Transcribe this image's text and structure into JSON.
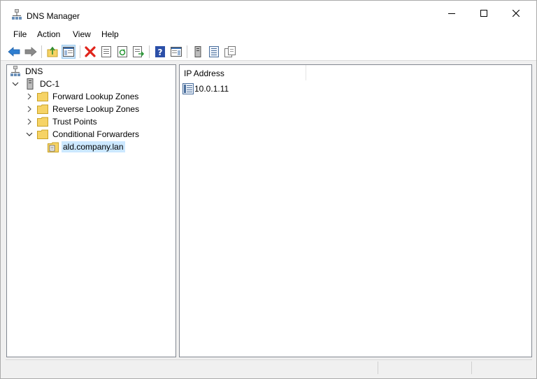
{
  "window": {
    "title": "DNS Manager"
  },
  "menu": {
    "items": [
      "File",
      "Action",
      "View",
      "Help"
    ]
  },
  "toolbar": {
    "buttons": [
      "back-icon",
      "forward-icon",
      "up-folder-icon",
      "show-hide-console-tree-icon",
      "delete-icon",
      "properties-icon",
      "refresh-icon",
      "export-list-icon",
      "help-icon",
      "show-hide-action-pane-icon",
      "server-icon",
      "list-icon",
      "copy-icon"
    ]
  },
  "tree": {
    "root": "DNS",
    "server": "DC-1",
    "folders": [
      {
        "label": "Forward Lookup Zones",
        "expanded": false
      },
      {
        "label": "Reverse Lookup Zones",
        "expanded": false
      },
      {
        "label": "Trust Points",
        "expanded": false
      },
      {
        "label": "Conditional Forwarders",
        "expanded": true
      }
    ],
    "selected_child": "ald.company.lan"
  },
  "details": {
    "columns": [
      "IP Address"
    ],
    "rows": [
      {
        "ip": "10.0.1.11"
      }
    ]
  },
  "colors": {
    "selection": "#cce8ff",
    "folder": "#f6d365",
    "accent_blue": "#1e73be",
    "delete_red": "#e0241b"
  }
}
